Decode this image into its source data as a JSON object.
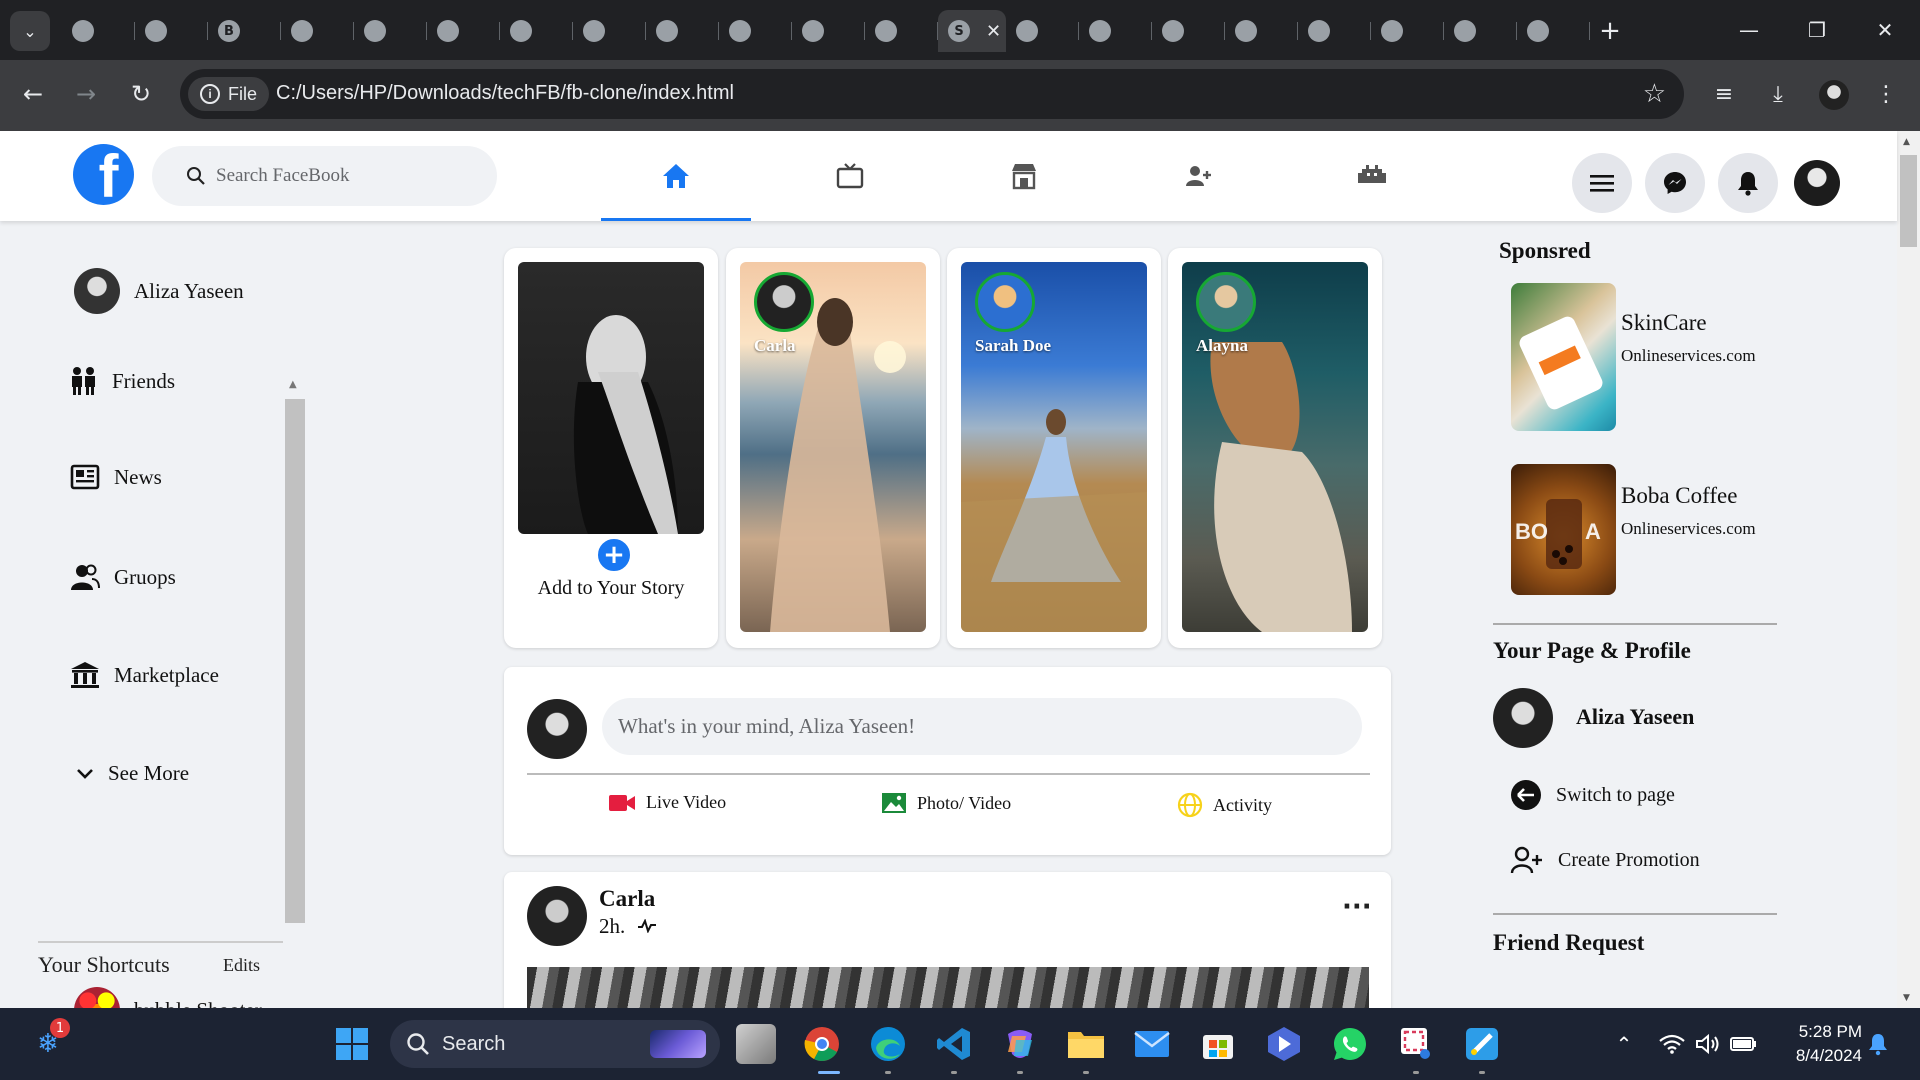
{
  "browser": {
    "tabs": [
      {
        "glyph": "",
        "active": false
      },
      {
        "glyph": "",
        "active": false
      },
      {
        "glyph": "B",
        "active": false
      },
      {
        "glyph": "",
        "active": false
      },
      {
        "glyph": "",
        "active": false
      },
      {
        "glyph": "",
        "active": false
      },
      {
        "glyph": "",
        "active": false
      },
      {
        "glyph": "",
        "active": false
      },
      {
        "glyph": "",
        "active": false
      },
      {
        "glyph": "",
        "active": false
      },
      {
        "glyph": "",
        "active": false
      },
      {
        "glyph": "",
        "active": false
      },
      {
        "glyph": "S",
        "active": true
      },
      {
        "glyph": "",
        "active": false
      },
      {
        "glyph": "",
        "active": false
      },
      {
        "glyph": "",
        "active": false
      },
      {
        "glyph": "",
        "active": false
      },
      {
        "glyph": "",
        "active": false
      },
      {
        "glyph": "",
        "active": false
      },
      {
        "glyph": "",
        "active": false
      },
      {
        "glyph": "",
        "active": false
      }
    ],
    "address_chip": "File",
    "url": "C:/Users/HP/Downloads/techFB/fb-clone/index.html"
  },
  "header": {
    "logo": "f",
    "search_placeholder": "Search FaceBook"
  },
  "sidebar": {
    "profile_name": "Aliza Yaseen",
    "items": [
      {
        "label": "Friends",
        "icon": "friends-icon"
      },
      {
        "label": "News",
        "icon": "news-icon"
      },
      {
        "label": "Gruops",
        "icon": "groups-icon"
      },
      {
        "label": "Marketplace",
        "icon": "marketplace-icon"
      }
    ],
    "see_more": "See More",
    "shortcuts_title": "Your Shortcuts",
    "shortcuts_edit": "Edits",
    "shortcuts": [
      {
        "label": "bubble Shooter"
      }
    ]
  },
  "stories": {
    "add_label": "Add to Your Story",
    "items": [
      {
        "name": "Carla"
      },
      {
        "name": "Sarah Doe"
      },
      {
        "name": "Alayna"
      }
    ]
  },
  "composer": {
    "placeholder": "What's in your mind, Aliza Yaseen!",
    "actions": [
      {
        "label": "Live Video",
        "color": "#e41e3f"
      },
      {
        "label": "Photo/ Video",
        "color": "#1b8a3a"
      },
      {
        "label": "Activity",
        "color": "#f7d21a"
      }
    ]
  },
  "post": {
    "author": "Carla",
    "time": "2h.",
    "more": "···"
  },
  "right": {
    "sponsored_title": "Sponsred",
    "ads": [
      {
        "name": "SkinCare",
        "site": "Onlineservices.com"
      },
      {
        "name": "Boba Coffee",
        "site": "Onlineservices.com"
      }
    ],
    "page_title": "Your Page & Profile",
    "page_name": "Aliza Yaseen",
    "switch_label": "Switch to page",
    "promo_label": "Create Promotion",
    "friend_request_title": "Friend Request"
  },
  "taskbar": {
    "search_label": "Search",
    "notification_count": "1",
    "time": "5:28 PM",
    "date": "8/4/2024"
  },
  "colors": {
    "brand": "#1877f2",
    "story_ring": "#16a833"
  }
}
